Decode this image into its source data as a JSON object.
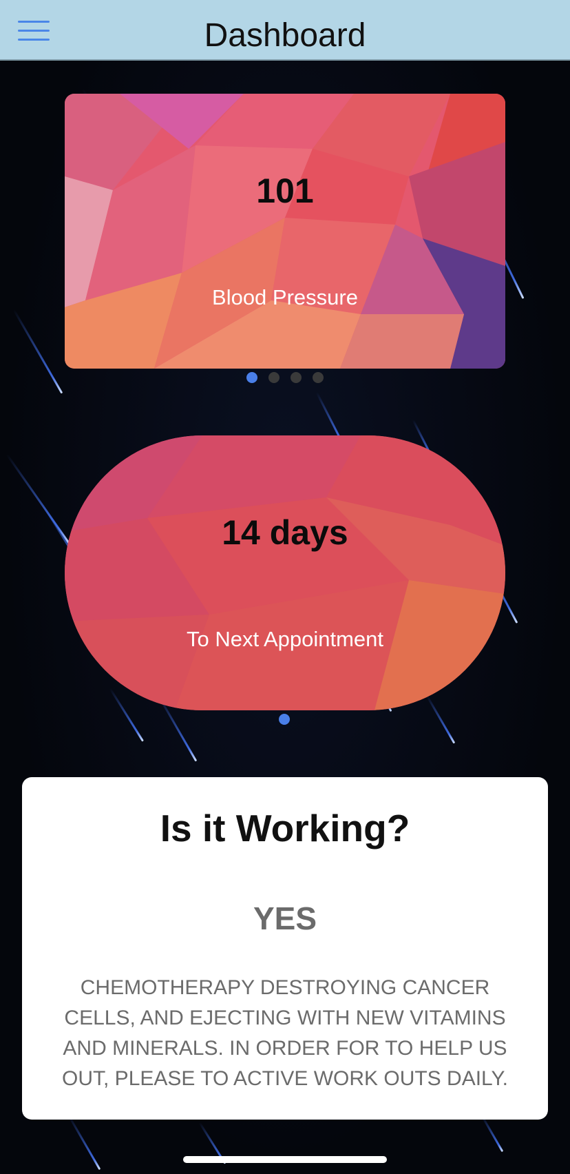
{
  "header": {
    "title": "Dashboard",
    "menu_icon": "hamburger-menu-icon"
  },
  "carousel_metrics": {
    "value": "101",
    "label": "Blood Pressure",
    "page_count": 4,
    "active_page": 1
  },
  "carousel_appointment": {
    "value": "14 days",
    "label": "To Next Appointment",
    "page_count": 1,
    "active_page": 1
  },
  "status_card": {
    "title": "Is it Working?",
    "answer": "YES",
    "body": "CHEMOTHERAPY DESTROYING CANCER CELLS, AND EJECTING WITH NEW VITAMINS AND MINERALS. IN ORDER FOR TO HELP US OUT, PLEASE TO ACTIVE WORK OUTS DAILY."
  },
  "colors": {
    "header_bg": "#b3d6e6",
    "accent": "#4a7fe8",
    "background": "#05070d"
  }
}
